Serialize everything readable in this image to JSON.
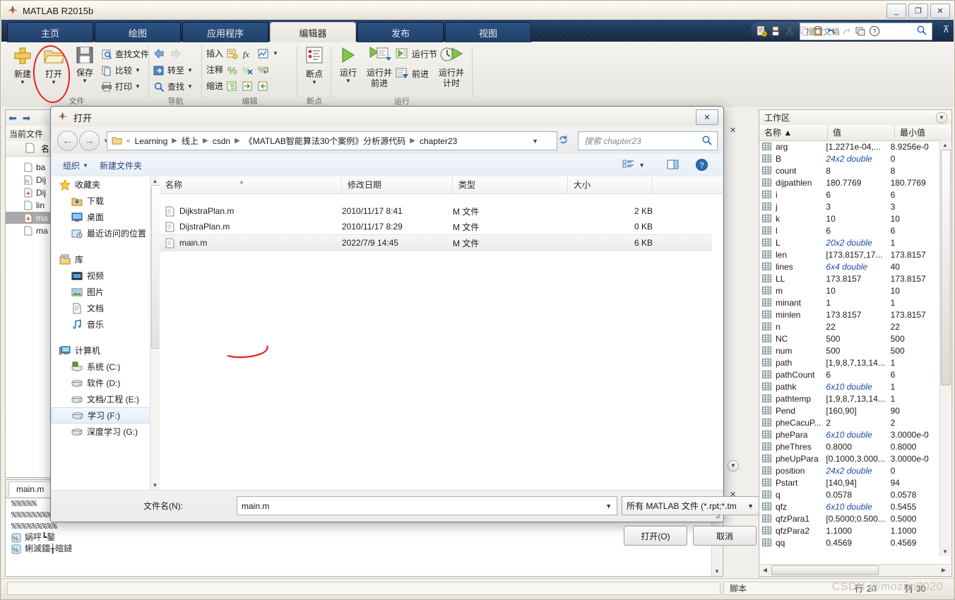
{
  "app": {
    "title": "MATLAB R2015b",
    "window_buttons": [
      "_",
      "❐",
      "✕"
    ]
  },
  "ribbon": {
    "tabs": [
      {
        "label": "主页",
        "active": false
      },
      {
        "label": "绘图",
        "active": false
      },
      {
        "label": "应用程序",
        "active": false
      },
      {
        "label": "编辑器",
        "active": true
      },
      {
        "label": "发布",
        "active": false
      },
      {
        "label": "视图",
        "active": false
      }
    ],
    "quick_access": [
      "new-script-icon",
      "save-icon",
      "cut-icon",
      "copy-icon",
      "paste-icon",
      "undo-icon",
      "redo-icon",
      "switch-window-icon",
      "help-icon"
    ],
    "search": {
      "placeholder": "搜索文档"
    },
    "groups": [
      {
        "name": "文件",
        "big_buttons": [
          {
            "label": "新建",
            "icon": "new-file-icon",
            "has_caret": true
          },
          {
            "label": "打开",
            "icon": "open-folder-icon",
            "has_caret": true
          },
          {
            "label": "保存",
            "icon": "save-disk-icon",
            "has_caret": true
          }
        ],
        "small_buttons": [
          {
            "label": "查找文件",
            "icon": "find-files-icon",
            "has_caret": false
          },
          {
            "label": "比较",
            "icon": "compare-icon",
            "has_caret": true
          },
          {
            "label": "打印",
            "icon": "print-icon",
            "has_caret": true
          }
        ]
      },
      {
        "name": "导航",
        "small_buttons": [
          {
            "label": "",
            "icon": "back-arrow-icon",
            "has_caret": false
          },
          {
            "label": "转至",
            "icon": "goto-icon",
            "has_caret": true
          },
          {
            "label": "查找",
            "icon": "search-icon",
            "has_caret": true
          }
        ]
      },
      {
        "name": "编辑",
        "rows": [
          {
            "label": "插入",
            "icons": [
              "insert-block-icon",
              "fx-icon",
              "figure-icon"
            ],
            "has_caret": true
          },
          {
            "label": "注释",
            "icons": [
              "comment-percent-icon",
              "uncomment-icon",
              "wrap-comment-icon"
            ],
            "has_caret": false
          },
          {
            "label": "缩进",
            "icons": [
              "smart-indent-icon",
              "indent-right-icon",
              "indent-left-icon"
            ],
            "has_caret": false
          }
        ]
      },
      {
        "name": "断点",
        "big_buttons": [
          {
            "label": "断点",
            "icon": "breakpoint-icon",
            "has_caret": true
          }
        ]
      },
      {
        "name": "运行",
        "big_buttons": [
          {
            "label": "运行",
            "icon": "run-icon",
            "has_caret": true
          },
          {
            "label": "运行并\n前进",
            "icon": "run-advance-icon",
            "has_caret": false
          },
          {
            "label": "运行并\n计时",
            "icon": "run-time-icon",
            "has_caret": false
          }
        ],
        "small_buttons": [
          {
            "label": "运行节",
            "icon": "run-section-icon",
            "has_caret": false
          },
          {
            "label": "前进",
            "icon": "advance-icon",
            "has_caret": false
          }
        ]
      }
    ]
  },
  "current_folder": {
    "title": "当前文件",
    "column_header": "名",
    "files": [
      "ba",
      "Dij",
      "Dij",
      "lin",
      "ma",
      "ma"
    ],
    "selected_index": 4
  },
  "editor": {
    "tab_label": "main.m",
    "lines": [
      "%%%%%",
      "%%%%%%%%%%%%%%%%%%%%%%%%%",
      "%%%%%%%%%"
    ],
    "fold_rows": [
      "娲呯┗鏊",
      "蜊滅鍿╁暄鐽"
    ]
  },
  "workspace": {
    "title": "工作区",
    "columns": [
      "名称 ▲",
      "值",
      "最小值"
    ],
    "rows": [
      {
        "name": "arg",
        "value": "[1.2271e-04,...",
        "min": "8.9256e-0",
        "italic": false
      },
      {
        "name": "B",
        "value": "24x2 double",
        "min": "0",
        "italic": true
      },
      {
        "name": "count",
        "value": "8",
        "min": "8",
        "italic": false
      },
      {
        "name": "dijpathlen",
        "value": "180.7769",
        "min": "180.7769",
        "italic": false
      },
      {
        "name": "i",
        "value": "6",
        "min": "6",
        "italic": false
      },
      {
        "name": "j",
        "value": "3",
        "min": "3",
        "italic": false
      },
      {
        "name": "k",
        "value": "10",
        "min": "10",
        "italic": false
      },
      {
        "name": "l",
        "value": "6",
        "min": "6",
        "italic": false
      },
      {
        "name": "L",
        "value": "20x2 double",
        "min": "1",
        "italic": true
      },
      {
        "name": "len",
        "value": "[173.8157,17...",
        "min": "173.8157",
        "italic": false
      },
      {
        "name": "lines",
        "value": "6x4 double",
        "min": "40",
        "italic": true
      },
      {
        "name": "LL",
        "value": "173.8157",
        "min": "173.8157",
        "italic": false
      },
      {
        "name": "m",
        "value": "10",
        "min": "10",
        "italic": false
      },
      {
        "name": "minant",
        "value": "1",
        "min": "1",
        "italic": false
      },
      {
        "name": "minlen",
        "value": "173.8157",
        "min": "173.8157",
        "italic": false
      },
      {
        "name": "n",
        "value": "22",
        "min": "22",
        "italic": false
      },
      {
        "name": "NC",
        "value": "500",
        "min": "500",
        "italic": false
      },
      {
        "name": "num",
        "value": "500",
        "min": "500",
        "italic": false
      },
      {
        "name": "path",
        "value": "[1,9,8,7,13,14...",
        "min": "1",
        "italic": false
      },
      {
        "name": "pathCount",
        "value": "6",
        "min": "6",
        "italic": false
      },
      {
        "name": "pathk",
        "value": "6x10 double",
        "min": "1",
        "italic": true
      },
      {
        "name": "pathtemp",
        "value": "[1,9,8,7,13,14...",
        "min": "1",
        "italic": false
      },
      {
        "name": "Pend",
        "value": "[160,90]",
        "min": "90",
        "italic": false
      },
      {
        "name": "pheCacuP...",
        "value": "2",
        "min": "2",
        "italic": false
      },
      {
        "name": "phePara",
        "value": "6x10 double",
        "min": "3.0000e-0",
        "italic": true
      },
      {
        "name": "pheThres",
        "value": "0.8000",
        "min": "0.8000",
        "italic": false
      },
      {
        "name": "pheUpPara",
        "value": "[0.1000,3.000...",
        "min": "3.0000e-0",
        "italic": false
      },
      {
        "name": "position",
        "value": "24x2 double",
        "min": "0",
        "italic": true
      },
      {
        "name": "Pstart",
        "value": "[140,94]",
        "min": "94",
        "italic": false
      },
      {
        "name": "q",
        "value": "0.0578",
        "min": "0.0578",
        "italic": false
      },
      {
        "name": "qfz",
        "value": "6x10 double",
        "min": "0.5455",
        "italic": true
      },
      {
        "name": "qfzPara1",
        "value": "[0.5000;0.500...",
        "min": "0.5000",
        "italic": false
      },
      {
        "name": "qfzPara2",
        "value": "1.1000",
        "min": "1.1000",
        "italic": false
      },
      {
        "name": "qq",
        "value": "0.4569",
        "min": "0.4569",
        "italic": false
      }
    ]
  },
  "status_bar": {
    "script_label": "脚本",
    "line_label": "行",
    "line_value": "20",
    "col_label": "列",
    "col_value": "30",
    "watermark": "CSDN @mozun2020"
  },
  "dialog": {
    "title": "打开",
    "close_label": "✕",
    "breadcrumb": {
      "prefix": "«",
      "items": [
        "Learning",
        "线上",
        "csdn",
        "《MATLAB智能算法30个案例》分析源代码",
        "chapter23"
      ]
    },
    "search": {
      "placeholder": "搜索 chapter23"
    },
    "toolbar": {
      "organize": "组织",
      "new_folder": "新建文件夹",
      "view_icon": "list-view-icon",
      "preview_icon": "preview-pane-icon",
      "help_icon": "help-icon"
    },
    "sidebar": [
      {
        "label": "收藏夹",
        "icon": "star-icon",
        "level": 0,
        "selected": false
      },
      {
        "label": "下载",
        "icon": "download-icon",
        "level": 1,
        "selected": false
      },
      {
        "label": "桌面",
        "icon": "desktop-icon",
        "level": 1,
        "selected": false
      },
      {
        "label": "最近访问的位置",
        "icon": "recent-places-icon",
        "level": 1,
        "selected": false
      },
      {
        "label": "库",
        "icon": "library-icon",
        "level": 0,
        "selected": false
      },
      {
        "label": "视频",
        "icon": "video-icon",
        "level": 1,
        "selected": false
      },
      {
        "label": "图片",
        "icon": "picture-icon",
        "level": 1,
        "selected": false
      },
      {
        "label": "文档",
        "icon": "document-icon",
        "level": 1,
        "selected": false
      },
      {
        "label": "音乐",
        "icon": "music-icon",
        "level": 1,
        "selected": false
      },
      {
        "label": "计算机",
        "icon": "computer-icon",
        "level": 0,
        "selected": false
      },
      {
        "label": "系统 (C:)",
        "icon": "system-drive-icon",
        "level": 1,
        "selected": false
      },
      {
        "label": "软件 (D:)",
        "icon": "drive-icon",
        "level": 1,
        "selected": false
      },
      {
        "label": "文档/工程 (E:)",
        "icon": "drive-icon",
        "level": 1,
        "selected": false
      },
      {
        "label": "学习 (F:)",
        "icon": "drive-icon",
        "level": 1,
        "selected": true
      },
      {
        "label": "深度学习 (G:)",
        "icon": "drive-icon",
        "level": 1,
        "selected": false
      }
    ],
    "list_columns": [
      "名称",
      "修改日期",
      "类型",
      "大小"
    ],
    "files": [
      {
        "name": "DijkstraPlan.m",
        "date": "2010/11/17 8:41",
        "type": "M 文件",
        "size": "2 KB",
        "selected": false
      },
      {
        "name": "DijstraPlan.m",
        "date": "2010/11/17 8:29",
        "type": "M 文件",
        "size": "0 KB",
        "selected": false
      },
      {
        "name": "main.m",
        "date": "2022/7/9 14:45",
        "type": "M 文件",
        "size": "6 KB",
        "selected": true
      }
    ],
    "filename_label": "文件名(N):",
    "filename_value": "main.m",
    "filter_value": "所有 MATLAB 文件 (*.rpt;*.tm",
    "open_button": "打开(O)",
    "cancel_button": "取消"
  }
}
